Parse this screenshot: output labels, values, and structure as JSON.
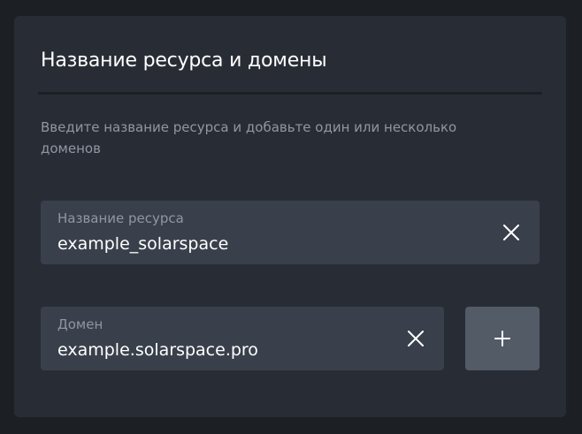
{
  "card": {
    "title": "Название ресурса и домены",
    "description": "Введите название ресурса и добавьте один или несколько доменов"
  },
  "resource_field": {
    "label": "Название ресурса",
    "value": "example_solarspace",
    "clear_icon": "close-icon"
  },
  "domain_field": {
    "label": "Домен",
    "value": "example.solarspace.pro",
    "clear_icon": "close-icon"
  },
  "add_button": {
    "icon": "plus-icon"
  },
  "colors": {
    "background": "#1c1f24",
    "card": "#282d35",
    "field": "#3a404b",
    "add_button": "#535b67",
    "text_primary": "#ffffff",
    "text_secondary": "#8f97a3"
  }
}
